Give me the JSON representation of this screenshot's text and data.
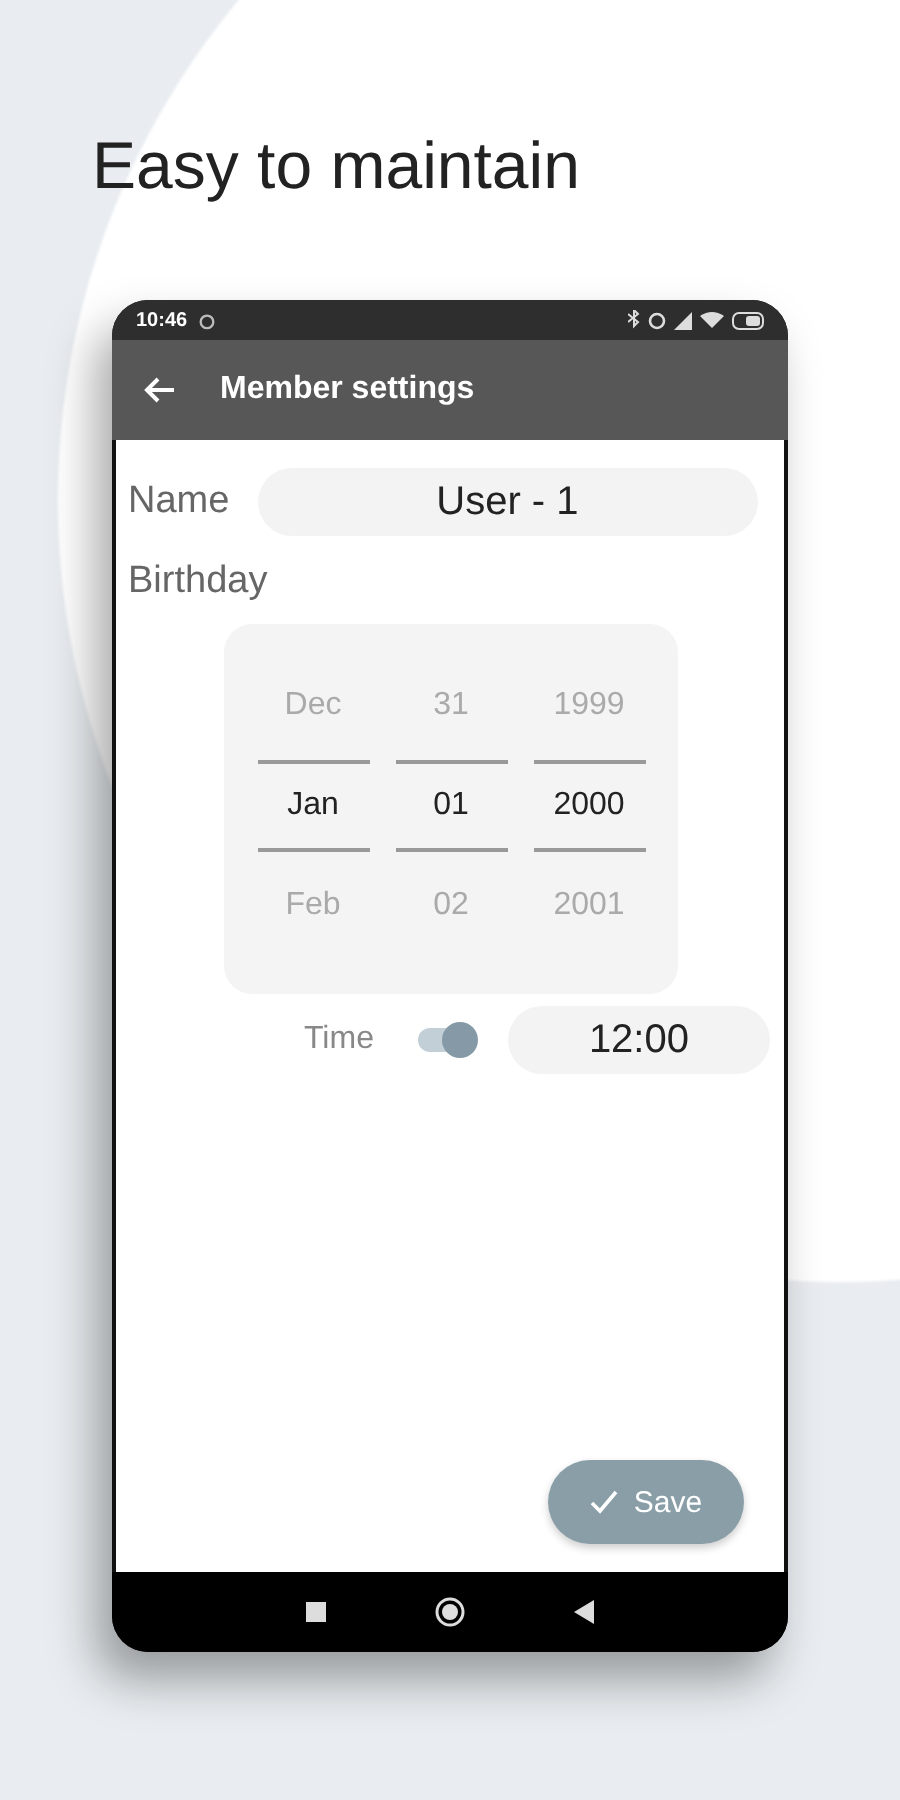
{
  "headline": "Easy to maintain",
  "status_bar": {
    "time": "10:46"
  },
  "app_bar": {
    "title": "Member settings"
  },
  "name": {
    "label": "Name",
    "value": "User - 1"
  },
  "birthday": {
    "label": "Birthday",
    "columns": [
      {
        "items": [
          {
            "label": "Dec",
            "selected": false
          },
          {
            "label": "Jan",
            "selected": true
          },
          {
            "label": "Feb",
            "selected": false
          }
        ]
      },
      {
        "items": [
          {
            "label": "31",
            "selected": false
          },
          {
            "label": "01",
            "selected": true
          },
          {
            "label": "02",
            "selected": false
          }
        ]
      },
      {
        "items": [
          {
            "label": "1999",
            "selected": false
          },
          {
            "label": "2000",
            "selected": true
          },
          {
            "label": "2001",
            "selected": false
          }
        ]
      }
    ]
  },
  "time": {
    "label": "Time",
    "on": true,
    "value": "12:00"
  },
  "save_button": {
    "label": "Save"
  }
}
